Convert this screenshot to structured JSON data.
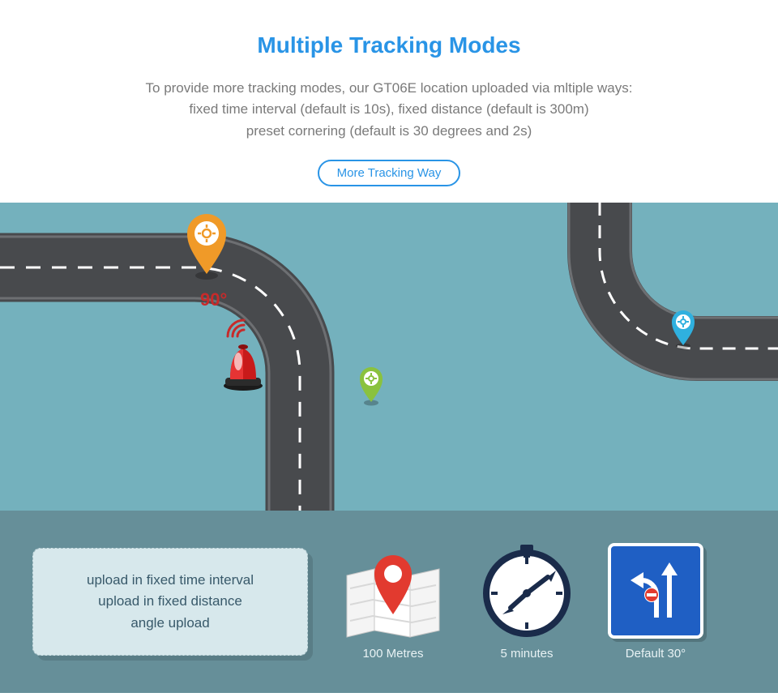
{
  "header": {
    "title": "Multiple Tracking Modes",
    "desc_line1": "To provide more tracking modes, our GT06E location uploaded via mltiple ways:",
    "desc_line2": "fixed time interval (default is 10s), fixed distance (default is 300m)",
    "desc_line3": "preset cornering (default is 30 degrees and 2s)",
    "cta": "More Tracking Way"
  },
  "map": {
    "corner_angle": "90°"
  },
  "card": {
    "line1": "upload in fixed time interval",
    "line2": "upload in fixed distance",
    "line3": "angle upload"
  },
  "features": {
    "distance_label": "100 Metres",
    "time_label": "5 minutes",
    "angle_label": "Default 30°"
  },
  "colors": {
    "brand_blue": "#2994e6",
    "map_bg": "#74b1bd",
    "bottom_bg": "#668f99",
    "road": "#484a4d",
    "siren_red": "#c81a1a",
    "pin_orange": "#f09a28",
    "pin_green": "#8ac23e",
    "pin_blue": "#2fb0df",
    "sign_blue": "#1f5fc4"
  }
}
